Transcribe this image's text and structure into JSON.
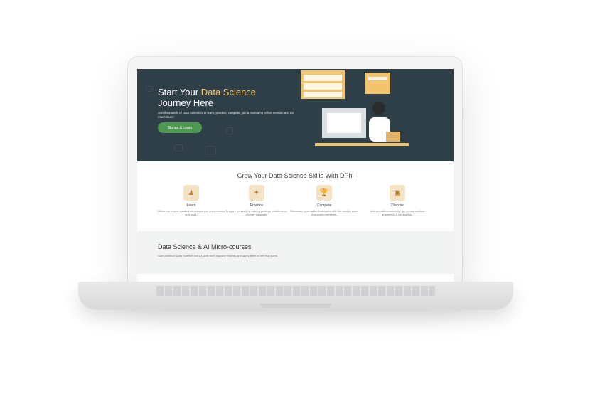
{
  "hero": {
    "title_line1_prefix": "Start Your ",
    "title_line1_highlight": "Data Science",
    "title_line2": "Journey Here",
    "subtitle": "Join thousands of Data Scientists to learn, practice, compete, join a bootcamp or live session and do much more!",
    "cta_label": "Signup & Learn",
    "accent_color": "#f2c46d",
    "cta_color": "#4e9a53",
    "background_color": "#2f3f48"
  },
  "skills": {
    "title": "Grow Your Data Science Skills With DPhi",
    "features": [
      {
        "icon": "learn-icon",
        "name": "Learn",
        "desc": "Utilize our expert curated courses as per your interest and pace."
      },
      {
        "icon": "practice-icon",
        "name": "Practice",
        "desc": "Prepare yourself by solving practice problems on diverse datasets."
      },
      {
        "icon": "trophy-icon",
        "name": "Compete",
        "desc": "Showcase your skills & compete with the best to solve real-world problems."
      },
      {
        "icon": "chat-icon",
        "name": "Discuss",
        "desc": "Interact with community, get your questions answered, & be inspired."
      }
    ]
  },
  "courses": {
    "title": "Data Science & AI Micro-courses",
    "subtitle": "Gain practical Data Science and AI skills from industry experts and apply them in the real world."
  }
}
